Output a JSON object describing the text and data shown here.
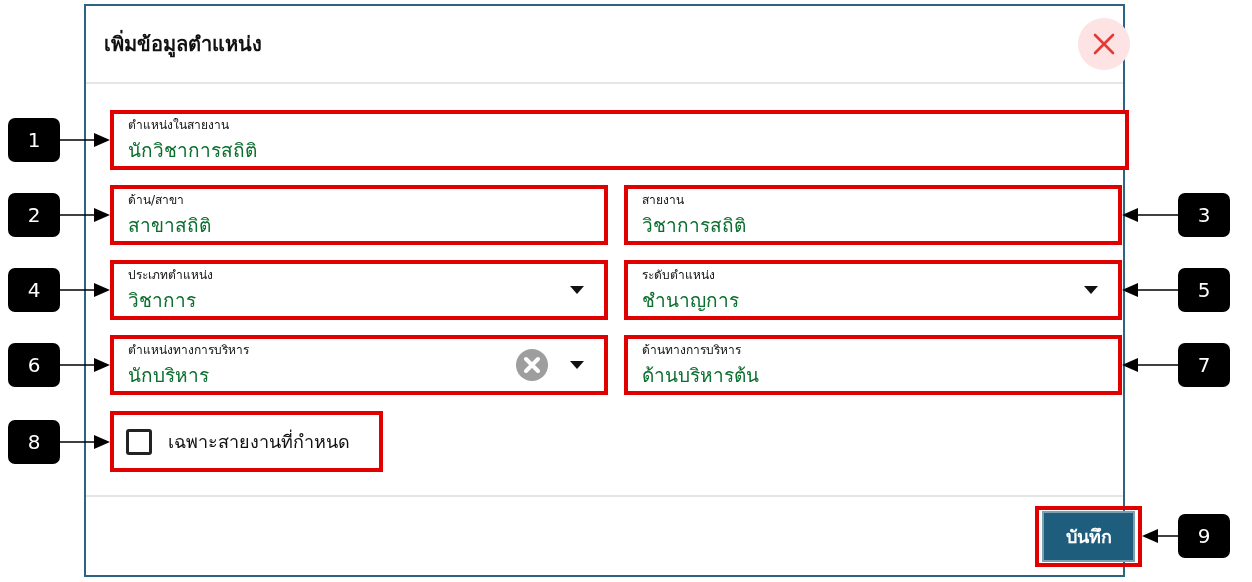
{
  "dialog": {
    "title": "เพิ่มข้อมูลตำแหน่ง"
  },
  "fields": [
    {
      "label": "ตำแหน่งในสายงาน",
      "value": "นักวิชาการสถิติ",
      "kind": "text",
      "highlighted": true,
      "full_width": true
    },
    {
      "label": "ด้าน/สาขา",
      "value": "สาขาสถิติ",
      "kind": "text",
      "highlighted": true,
      "full_width": false
    },
    {
      "label": "สายงาน",
      "value": "วิชาการสถิติ",
      "kind": "text",
      "highlighted": true,
      "full_width": false
    },
    {
      "label": "ประเภทตำแหน่ง",
      "value": "วิชาการ",
      "kind": "select",
      "clearable": false,
      "highlighted": true,
      "full_width": false
    },
    {
      "label": "ระดับตำแหน่ง",
      "value": "ชำนาญการ",
      "kind": "select",
      "clearable": false,
      "highlighted": true,
      "full_width": false
    },
    {
      "label": "ตำแหน่งทางการบริหาร",
      "value": "นักบริหาร",
      "kind": "select",
      "clearable": true,
      "highlighted": true,
      "full_width": false
    },
    {
      "label": "ด้านทางการบริหาร",
      "value": "ด้านบริหารต้น",
      "kind": "text",
      "highlighted": true,
      "full_width": false
    }
  ],
  "checkbox": {
    "label": "เฉพาะสายงานที่กำหนด",
    "checked": false,
    "highlighted": true
  },
  "save_button": {
    "label": "บันทึก",
    "highlighted": true
  },
  "callouts": [
    {
      "label": "1",
      "kind": "left"
    },
    {
      "label": "2",
      "kind": "left"
    },
    {
      "label": "3",
      "kind": "right"
    },
    {
      "label": "4",
      "kind": "left"
    },
    {
      "label": "5",
      "kind": "right"
    },
    {
      "label": "6",
      "kind": "left"
    },
    {
      "label": "7",
      "kind": "right"
    },
    {
      "label": "8",
      "kind": "left"
    },
    {
      "label": "9",
      "kind": "right"
    }
  ]
}
